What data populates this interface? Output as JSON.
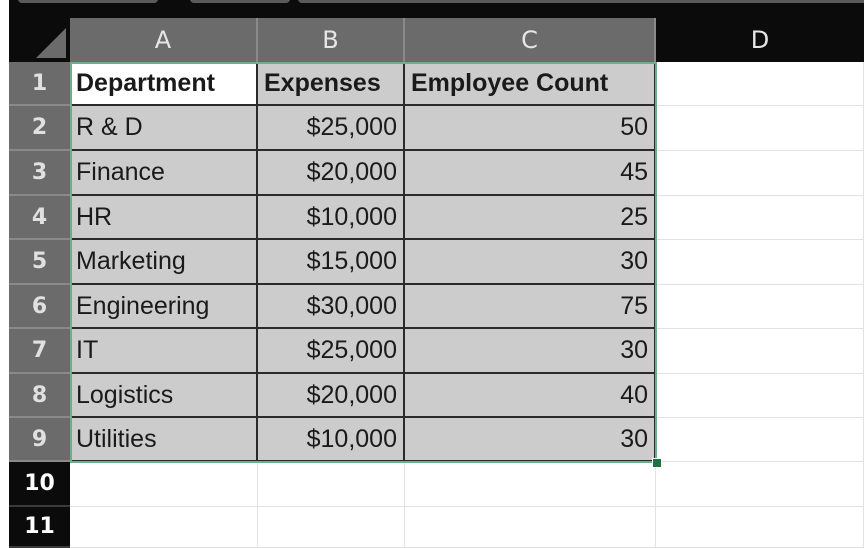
{
  "app": {
    "name": "Spreadsheet"
  },
  "columns": [
    "A",
    "B",
    "C",
    "D"
  ],
  "rows": [
    "1",
    "2",
    "3",
    "4",
    "5",
    "6",
    "7",
    "8",
    "9",
    "10",
    "11"
  ],
  "header_row": [
    "Department",
    "Expenses",
    "Employee Count"
  ],
  "table": [
    [
      "R & D",
      "$25,000",
      "50"
    ],
    [
      "Finance",
      "$20,000",
      "45"
    ],
    [
      "HR",
      "$10,000",
      "25"
    ],
    [
      "Marketing",
      "$15,000",
      "30"
    ],
    [
      "Engineering",
      "$30,000",
      "75"
    ],
    [
      "IT",
      "$25,000",
      "30"
    ],
    [
      "Logistics",
      "$20,000",
      "40"
    ],
    [
      "Utilities",
      "$10,000",
      "30"
    ]
  ],
  "selection": {
    "range": "A1:C9",
    "active_cell": "A1"
  },
  "colors": {
    "selection_border": "#6fae8a",
    "fill_handle": "#1e7145",
    "selected_fill": "#cccccc",
    "header_bg": "#6b6b6b"
  }
}
